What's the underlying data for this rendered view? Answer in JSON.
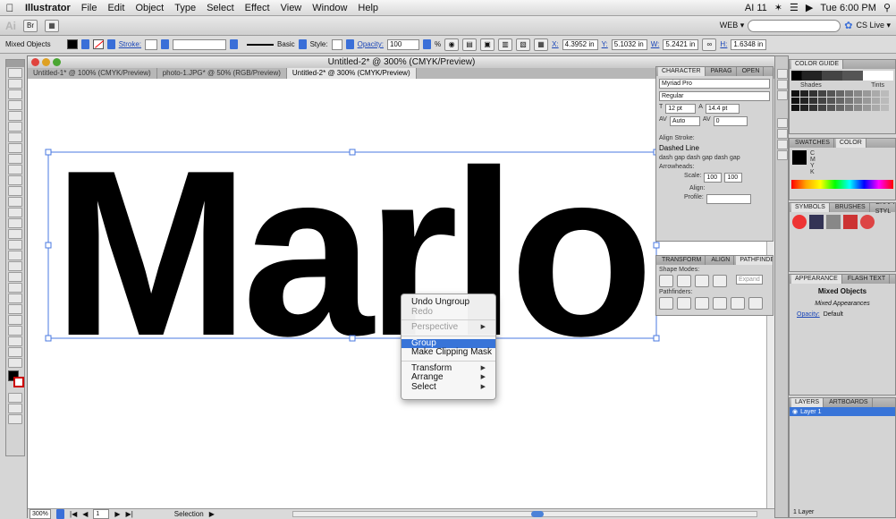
{
  "menubar": {
    "app": "Illustrator",
    "items": [
      "File",
      "Edit",
      "Object",
      "Type",
      "Select",
      "Effect",
      "View",
      "Window",
      "Help"
    ],
    "right": {
      "status": "AI 11",
      "clock": "Tue 6:00 PM"
    }
  },
  "appbar": {
    "logo": "Ai",
    "workspace": "WEB ▾",
    "cslive": "CS Live ▾"
  },
  "control": {
    "selection": "Mixed Objects",
    "stroke": "Stroke:",
    "basic": "Basic",
    "style": "Style:",
    "opacity_label": "Opacity:",
    "opacity": "100",
    "pct": "%",
    "x_label": "X:",
    "x": "4.3952 in",
    "y_label": "Y:",
    "y": "5.1032 in",
    "w_label": "W:",
    "w": "5.2421 in",
    "h_label": "H:",
    "h": "1.6348 in"
  },
  "document": {
    "title": "Untitled-2* @ 300% (CMYK/Preview)",
    "tabs": [
      "Untitled-1* @ 100% (CMYK/Preview)",
      "photo-1.JPG* @ 50% (RGB/Preview)",
      "Untitled-2* @ 300% (CMYK/Preview)"
    ],
    "artwork_text": "Marlo"
  },
  "status": {
    "zoom": "300%",
    "page": "1",
    "tool": "Selection"
  },
  "context_menu": {
    "items": [
      {
        "label": "Undo Ungroup",
        "enabled": true
      },
      {
        "label": "Redo",
        "enabled": false
      },
      {
        "label": "Perspective",
        "enabled": false,
        "sub": true
      },
      {
        "label": "Group",
        "enabled": true,
        "highlight": true
      },
      {
        "label": "Make Clipping Mask",
        "enabled": true
      },
      {
        "label": "Transform",
        "enabled": true,
        "sub": true
      },
      {
        "label": "Arrange",
        "enabled": true,
        "sub": true
      },
      {
        "label": "Select",
        "enabled": true,
        "sub": true
      }
    ]
  },
  "character": {
    "tabs": [
      "CHARACTER",
      "PARAG",
      "OPEN"
    ],
    "font": "Myriad Pro",
    "style": "Regular",
    "size": "12 pt",
    "leading": "14.4 pt",
    "kerning": "Auto",
    "tracking": "0"
  },
  "stroke_panel": {
    "align_label": "Align Stroke:",
    "dashed": "Dashed Line",
    "dash_labels": [
      "dash",
      "gap",
      "dash",
      "gap",
      "dash",
      "gap"
    ],
    "arrowheads": "Arrowheads:",
    "scale": "Scale:",
    "scale1": "100",
    "scale2": "100",
    "pct": "%",
    "align": "Align:",
    "profile": "Profile:"
  },
  "pathfinder": {
    "tabs": [
      "TRANSFORM",
      "ALIGN",
      "PATHFINDER"
    ],
    "shape_modes": "Shape Modes:",
    "pathfinders": "Pathfinders:",
    "expand": "Expand"
  },
  "color_guide": {
    "title": "COLOR GUIDE",
    "shades": "Shades",
    "tints": "Tints"
  },
  "swatches": {
    "tabs": [
      "SWATCHES",
      "COLOR"
    ],
    "channels": [
      "C",
      "M",
      "Y",
      "K"
    ]
  },
  "symbols": {
    "tabs": [
      "SYMBOLS",
      "BRUSHES",
      "GRAPHIC STYL"
    ]
  },
  "appearance": {
    "tabs": [
      "APPEARANCE",
      "FLASH TEXT"
    ],
    "title": "Mixed Objects",
    "sub": "Mixed Appearances",
    "opacity_label": "Opacity:",
    "opacity_val": "Default"
  },
  "layers": {
    "tabs": [
      "LAYERS",
      "ARTBOARDS"
    ],
    "layer": "Layer 1",
    "footer": "1 Layer"
  }
}
